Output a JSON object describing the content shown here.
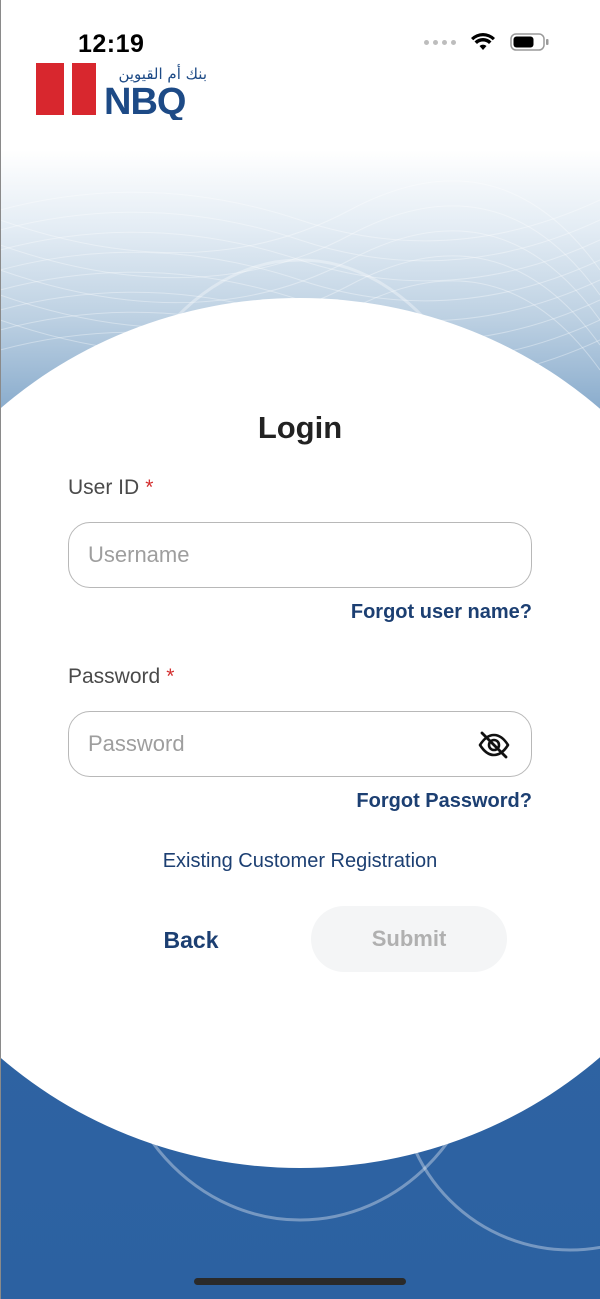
{
  "status_bar": {
    "time": "12:19"
  },
  "logo": {
    "arabic_name": "بنك أم القيوين",
    "latin_name": "NBQ",
    "colors": {
      "red": "#d8272e",
      "blue": "#1d4a86"
    }
  },
  "form": {
    "title": "Login",
    "user_id": {
      "label": "User ID",
      "required_mark": "*",
      "placeholder": "Username",
      "value": ""
    },
    "forgot_username_link": "Forgot user name?",
    "password": {
      "label": "Password",
      "required_mark": "*",
      "placeholder": "Password",
      "value": "",
      "toggle_icon": "eye-slash-icon"
    },
    "forgot_password_link": "Forgot Password?",
    "registration_link": "Existing Customer Registration",
    "back_label": "Back",
    "submit_label": "Submit"
  },
  "colors": {
    "link": "#1c3f72",
    "required": "#d32f2f",
    "background_blue": "#2c61a1"
  }
}
